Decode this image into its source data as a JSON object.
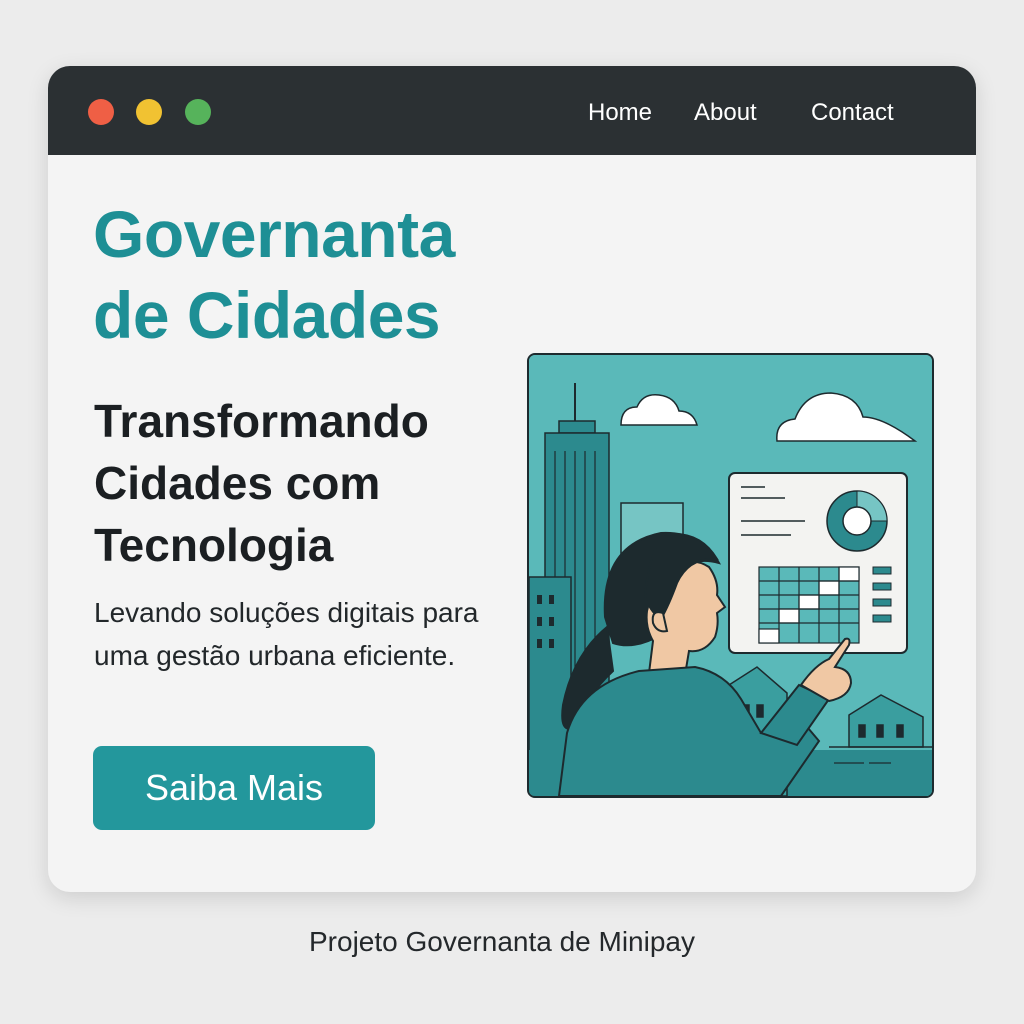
{
  "window": {
    "nav": {
      "home": "Home",
      "about": "About",
      "contact": "Contact"
    }
  },
  "hero": {
    "brand_title": "Governanta de Cidades",
    "headline": "Transformando Cidades com Tecnologia",
    "subtext": "Levando soluções digitais para uma gestão urbana eficiente.",
    "cta_label": "Saiba Mais"
  },
  "illustration": {
    "subject": "woman-pointing-at-dashboard-over-city-skyline",
    "icons": [
      "cloud-icon",
      "skyscraper-icon",
      "house-icon",
      "donut-chart-icon",
      "grid-table-icon"
    ]
  },
  "footer": {
    "caption": "Projeto Governanta de Minipay"
  },
  "colors": {
    "accent": "#23979c",
    "title_teal": "#1e8f95",
    "titlebar": "#2b3033",
    "window_bg": "#f4f4f4",
    "page_bg": "#ececec",
    "traffic_red": "#ef5f45",
    "traffic_yellow": "#f1c232",
    "traffic_green": "#56b35b"
  }
}
